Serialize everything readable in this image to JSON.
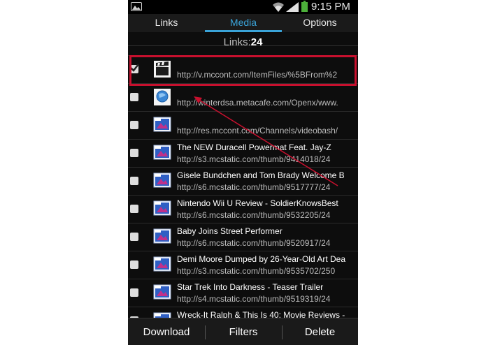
{
  "status_bar": {
    "time": "9:15 PM"
  },
  "tabs": [
    {
      "label": "Links"
    },
    {
      "label": "Media"
    },
    {
      "label": "Options"
    }
  ],
  "active_tab": "Media",
  "count": {
    "label": "Links:",
    "value": "24"
  },
  "rows": [
    {
      "checked": true,
      "icon": "video-clapper-icon",
      "title": "",
      "url": "http://v.mccont.com/ItemFiles/%5BFrom%2"
    },
    {
      "checked": false,
      "icon": "globe-icon",
      "title": "",
      "url": "http://winterdsa.metacafe.com/Openx/www."
    },
    {
      "checked": false,
      "icon": "image-icon",
      "title": "",
      "url": "http://res.mccont.com/Channels/videobash/"
    },
    {
      "checked": false,
      "icon": "image-icon",
      "title": "The NEW Duracell Powermat Feat. Jay-Z",
      "url": "http://s3.mcstatic.com/thumb/9414018/24"
    },
    {
      "checked": false,
      "icon": "image-icon",
      "title": "Gisele Bundchen and Tom Brady Welcome B",
      "url": "http://s6.mcstatic.com/thumb/9517777/24"
    },
    {
      "checked": false,
      "icon": "image-icon",
      "title": "Nintendo Wii U Review - SoldierKnowsBest",
      "url": "http://s6.mcstatic.com/thumb/9532205/24"
    },
    {
      "checked": false,
      "icon": "image-icon",
      "title": "Baby Joins Street Performer",
      "url": "http://s6.mcstatic.com/thumb/9520917/24"
    },
    {
      "checked": false,
      "icon": "image-icon",
      "title": "Demi Moore Dumped by 26-Year-Old Art Dea",
      "url": "http://s3.mcstatic.com/thumb/9535702/250"
    },
    {
      "checked": false,
      "icon": "image-icon",
      "title": "Star Trek Into Darkness - Teaser Trailer",
      "url": "http://s4.mcstatic.com/thumb/9519319/24"
    },
    {
      "checked": false,
      "icon": "image-icon",
      "title": "Wreck-It Ralph & This Is 40: Movie Reviews -",
      "url": ""
    }
  ],
  "bottom_bar": {
    "download": "Download",
    "filters": "Filters",
    "delete": "Delete"
  },
  "colors": {
    "accent": "#3aa3d8",
    "highlight": "#c8102e",
    "background": "#0d0d0d"
  }
}
